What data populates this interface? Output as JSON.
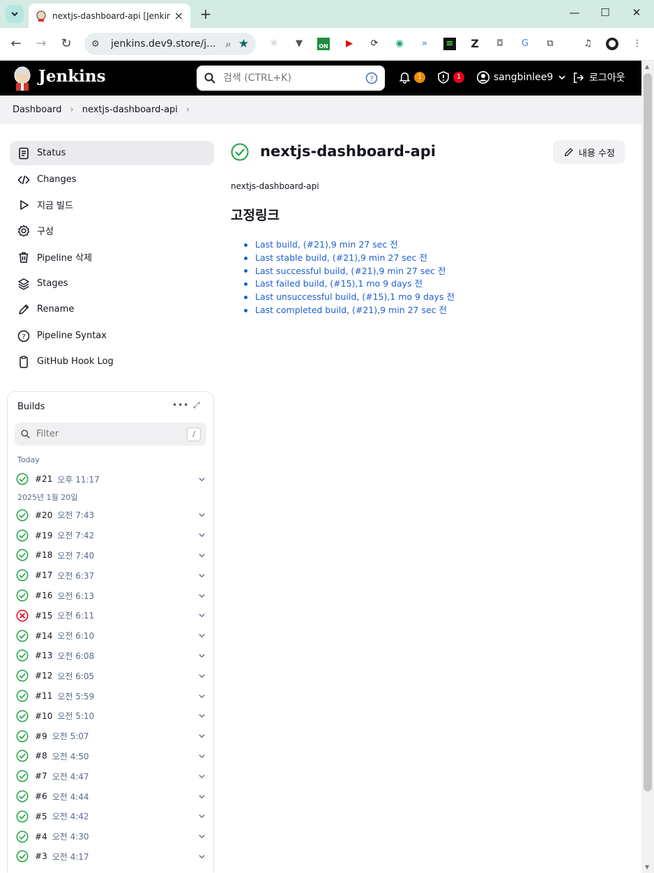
{
  "browser": {
    "tab_title": "nextjs-dashboard-api [Jenkins]",
    "url": "jenkins.dev9.store/j...",
    "extension_labels": [
      "ON",
      "Z"
    ]
  },
  "header": {
    "brand": "Jenkins",
    "search_placeholder": "검색 (CTRL+K)",
    "notifications_count": "1",
    "security_count": "1",
    "username": "sangbinlee9",
    "logout_label": "로그아웃",
    "colors": {
      "bar": "#000000",
      "notif_badge": "#f08c00",
      "security_badge": "#e6001f"
    }
  },
  "breadcrumb": [
    "Dashboard",
    "nextjs-dashboard-api"
  ],
  "sidebar": {
    "items": [
      {
        "label": "Status",
        "icon": "document-icon"
      },
      {
        "label": "Changes",
        "icon": "code-icon"
      },
      {
        "label": "지금 빌드",
        "icon": "play-icon"
      },
      {
        "label": "구성",
        "icon": "gear-icon"
      },
      {
        "label": "Pipeline 삭제",
        "icon": "trash-icon"
      },
      {
        "label": "Stages",
        "icon": "layers-icon"
      },
      {
        "label": "Rename",
        "icon": "pencil-icon"
      },
      {
        "label": "Pipeline Syntax",
        "icon": "help-icon"
      },
      {
        "label": "GitHub Hook Log",
        "icon": "clipboard-icon"
      }
    ]
  },
  "builds": {
    "title": "Builds",
    "filter_placeholder": "Filter",
    "filter_key": "/",
    "groups": [
      {
        "label": "Today",
        "builds": [
          {
            "number": "#21",
            "time": "오후 11:17",
            "status": "success"
          }
        ]
      },
      {
        "label": "2025년 1월 20일",
        "builds": [
          {
            "number": "#20",
            "time": "오전 7:43",
            "status": "success"
          },
          {
            "number": "#19",
            "time": "오전 7:42",
            "status": "success"
          },
          {
            "number": "#18",
            "time": "오전 7:40",
            "status": "success"
          },
          {
            "number": "#17",
            "time": "오전 6:37",
            "status": "success"
          },
          {
            "number": "#16",
            "time": "오전 6:13",
            "status": "success"
          },
          {
            "number": "#15",
            "time": "오전 6:11",
            "status": "failed"
          },
          {
            "number": "#14",
            "time": "오전 6:10",
            "status": "success"
          },
          {
            "number": "#13",
            "time": "오전 6:08",
            "status": "success"
          },
          {
            "number": "#12",
            "time": "오전 6:05",
            "status": "success"
          },
          {
            "number": "#11",
            "time": "오전 5:59",
            "status": "success"
          },
          {
            "number": "#10",
            "time": "오전 5:10",
            "status": "success"
          },
          {
            "number": "#9",
            "time": "오전 5:07",
            "status": "success"
          },
          {
            "number": "#8",
            "time": "오전 4:50",
            "status": "success"
          },
          {
            "number": "#7",
            "time": "오전 4:47",
            "status": "success"
          },
          {
            "number": "#6",
            "time": "오전 4:44",
            "status": "success"
          },
          {
            "number": "#5",
            "time": "오전 4:42",
            "status": "success"
          },
          {
            "number": "#4",
            "time": "오전 4:30",
            "status": "success"
          },
          {
            "number": "#3",
            "time": "오전 4:17",
            "status": "success"
          }
        ]
      }
    ],
    "colors": {
      "success": "#1ea446",
      "failed": "#e6001f"
    }
  },
  "main": {
    "title": "nextjs-dashboard-api",
    "edit_label": "내용 수정",
    "description": "nextjs-dashboard-api",
    "permalinks_title": "고정링크",
    "permalinks": [
      "Last build, (#21),9 min 27 sec 전",
      "Last stable build, (#21),9 min 27 sec 전",
      "Last successful build, (#21),9 min 27 sec 전",
      "Last failed build, (#15),1 mo 9 days 전",
      "Last unsuccessful build, (#15),1 mo 9 days 전",
      "Last completed build, (#21),9 min 27 sec 전"
    ]
  }
}
